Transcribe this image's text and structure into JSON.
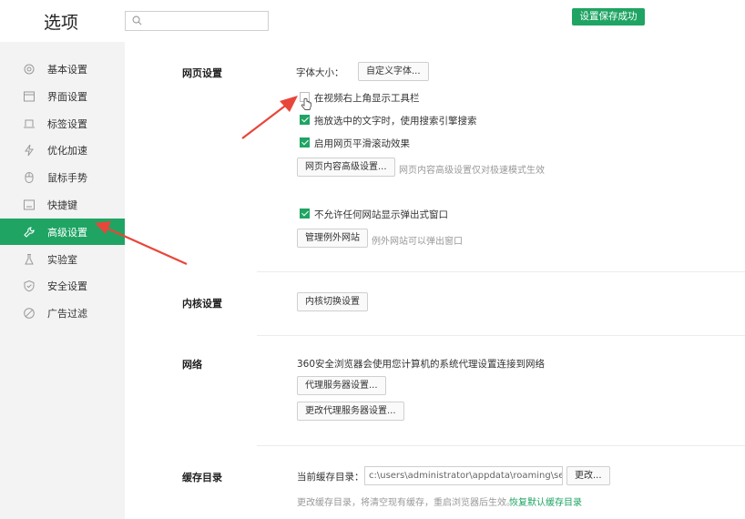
{
  "header": {
    "title": "选项",
    "search": {
      "placeholder": "",
      "value": ""
    },
    "toast": "设置保存成功"
  },
  "sidebar": {
    "items": [
      {
        "label": "基本设置",
        "icon": "gear-icon"
      },
      {
        "label": "界面设置",
        "icon": "window-icon"
      },
      {
        "label": "标签设置",
        "icon": "tab-icon"
      },
      {
        "label": "优化加速",
        "icon": "lightning-icon"
      },
      {
        "label": "鼠标手势",
        "icon": "mouse-icon"
      },
      {
        "label": "快捷键",
        "icon": "keyboard-icon"
      },
      {
        "label": "高级设置",
        "icon": "wrench-icon",
        "active": true
      },
      {
        "label": "实验室",
        "icon": "flask-icon"
      },
      {
        "label": "安全设置",
        "icon": "shield-icon"
      },
      {
        "label": "广告过滤",
        "icon": "block-icon"
      }
    ]
  },
  "webpage": {
    "title": "网页设置",
    "font_size_label": "字体大小：",
    "custom_font_btn": "自定义字体...",
    "options": [
      {
        "label": "在视频右上角显示工具栏",
        "checked": false
      },
      {
        "label": "拖放选中的文字时，使用搜索引擎搜索",
        "checked": true
      },
      {
        "label": "启用网页平滑滚动效果",
        "checked": true
      }
    ],
    "advanced_btn": "网页内容高级设置...",
    "advanced_hint": "网页内容高级设置仅对极速模式生效",
    "popup_option": {
      "label": "不允许任何网站显示弹出式窗口",
      "checked": true
    },
    "exceptions_btn": "管理例外网站",
    "exceptions_hint": "例外网站可以弹出窗口"
  },
  "kernel": {
    "title": "内核设置",
    "switch_btn": "内核切换设置"
  },
  "network": {
    "title": "网络",
    "desc": "360安全浏览器会使用您计算机的系统代理设置连接到网络",
    "proxy_btn": "代理服务器设置...",
    "change_proxy_btn": "更改代理服务器设置..."
  },
  "cache": {
    "title": "缓存目录",
    "current_label": "当前缓存目录：",
    "path": "c:\\users\\administrator\\appdata\\roaming\\secore",
    "change_btn": "更改...",
    "hint": "更改缓存目录，将清空现有缓存，重启浏览器后生效。",
    "restore_link": "恢复默认缓存目录"
  },
  "colors": {
    "accent": "#1fa463",
    "arrow": "#e8463a",
    "sidebar_bg": "#f3f3f3"
  }
}
